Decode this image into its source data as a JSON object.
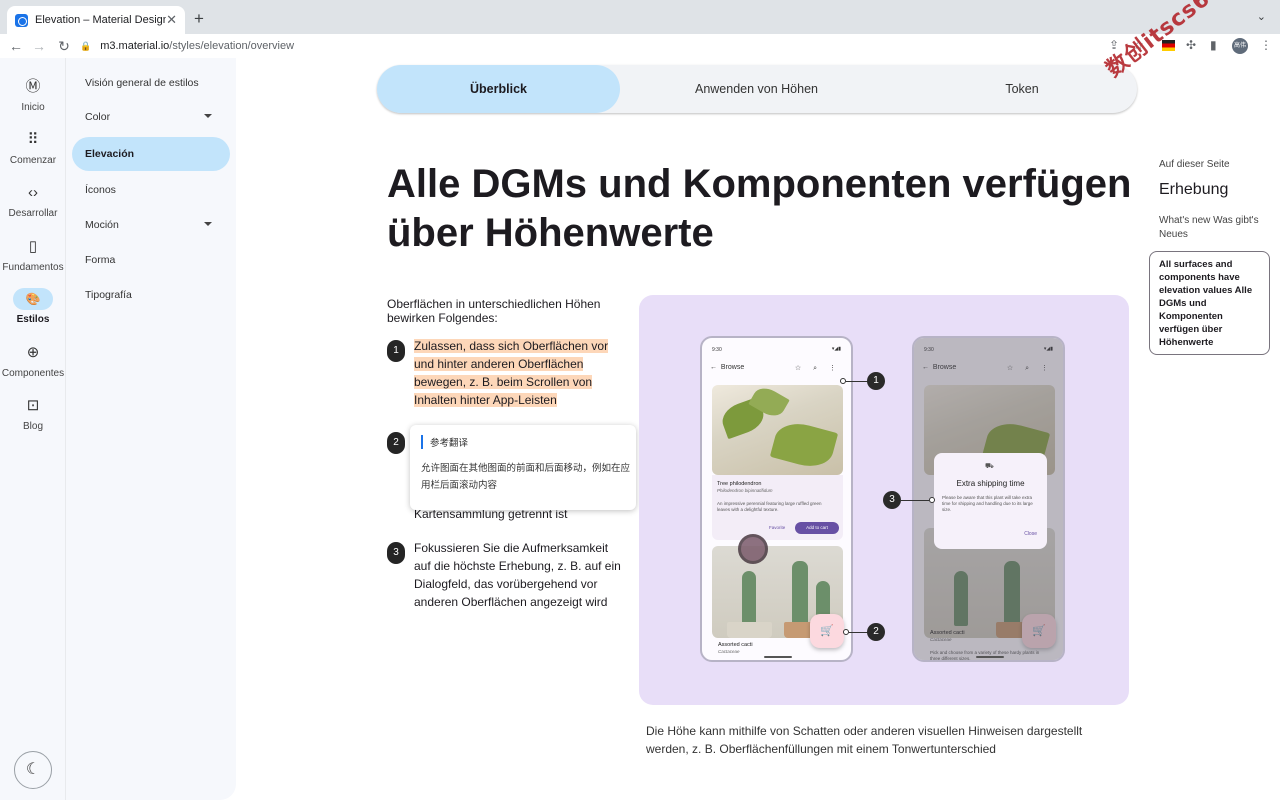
{
  "browser": {
    "tab_title": "Elevation – Material Design 3",
    "close_glyph": "✕",
    "new_tab_glyph": "+",
    "menu_glyph": "⌄",
    "url_host": "m3.material.io",
    "url_path": "/styles/elevation/overview",
    "profile_initials": "高伟"
  },
  "rail": {
    "items": [
      {
        "label": "Inicio",
        "icon": "material-logo-icon",
        "glyph": "Ⓜ"
      },
      {
        "label": "Comenzar",
        "icon": "apps-grid-icon",
        "glyph": "⠿"
      },
      {
        "label": "Desarrollar",
        "icon": "code-icon",
        "glyph": "‹›"
      },
      {
        "label": "Fundamentos",
        "icon": "book-icon",
        "glyph": "▯"
      },
      {
        "label": "Estilos",
        "icon": "palette-icon",
        "glyph": "🎨"
      },
      {
        "label": "Componentes",
        "icon": "add-circle-icon",
        "glyph": "⊕"
      },
      {
        "label": "Blog",
        "icon": "star-box-icon",
        "glyph": "⊡"
      }
    ],
    "active": "Estilos",
    "dark_mode_glyph": "☾"
  },
  "subnav": {
    "items": [
      "Visión general de estilos",
      "Color",
      "Elevación",
      "Íconos",
      "Moción",
      "Forma",
      "Tipografía"
    ],
    "active": "Elevación"
  },
  "tabs": [
    "Überblick",
    "Anwenden von Höhen",
    "Token"
  ],
  "active_tab": "Überblick",
  "watermark": "数创itscs66",
  "heading": "Alle DGMs und Komponenten verfügen über Höhenwerte",
  "intro": "Oberflächen in unterschiedlichen Höhen bewirken Folgendes:",
  "list": [
    {
      "num": "1",
      "text": "Zulassen, dass sich Oberflächen vor und hinter anderen Oberflächen bewegen, z. B. beim Scrollen von Inhalten hinter App-Leisten"
    },
    {
      "num": "2",
      "visible_text": "Kartensammlung getrennt ist"
    },
    {
      "num": "3",
      "text": "Fokussieren Sie die Aufmerksamkeit auf die höchste Erhebung, z. B. auf ein Dialogfeld, das vorübergehend vor anderen Oberflächen angezeigt wird"
    }
  ],
  "translation_popup": {
    "title": "参考翻译",
    "body": "允许图面在其他图面的前面和后面移动，例如在应用栏后面滚动内容"
  },
  "illustration": {
    "time": "9:30",
    "app_title": "Browse",
    "back_glyph": "←",
    "appbar_icons": "☆ ⌕ ⋮",
    "status_icons": "▾◢▮",
    "cart_glyph": "🛒",
    "product1_name": "Tree philodendron",
    "product1_sci": "Philodendron bipinnatifidum",
    "product1_desc": "An impressive perennial featuring large ruffled green leaves with a delightful texture.",
    "favorite": "Favorite",
    "add_to_cart": "Add to cart",
    "product2_name": "Assorted cacti",
    "product2_sci": "Cactaceae",
    "product2_desc": "Pick and choose from a variety of these hardy plants in three different sizes.",
    "dialog_icon": "⛟",
    "dialog_title": "Extra shipping time",
    "dialog_body": "Please be aware that this plant will take extra time for shipping and handling due to its large size.",
    "dialog_close": "Close",
    "callouts": [
      "1",
      "2",
      "3"
    ]
  },
  "caption": "Die Höhe kann mithilfe von Schatten oder anderen visuellen Hinweisen dargestellt werden, z. B. Oberflächenfüllungen mit einem Tonwertunterschied",
  "toc": {
    "label": "Auf dieser Seite",
    "heading": "Erhebung",
    "link1": "What's new Was gibt's Neues",
    "active_link": "All surfaces and components have elevation values Alle DGMs und Komponenten verfügen über Höhenwerte"
  }
}
